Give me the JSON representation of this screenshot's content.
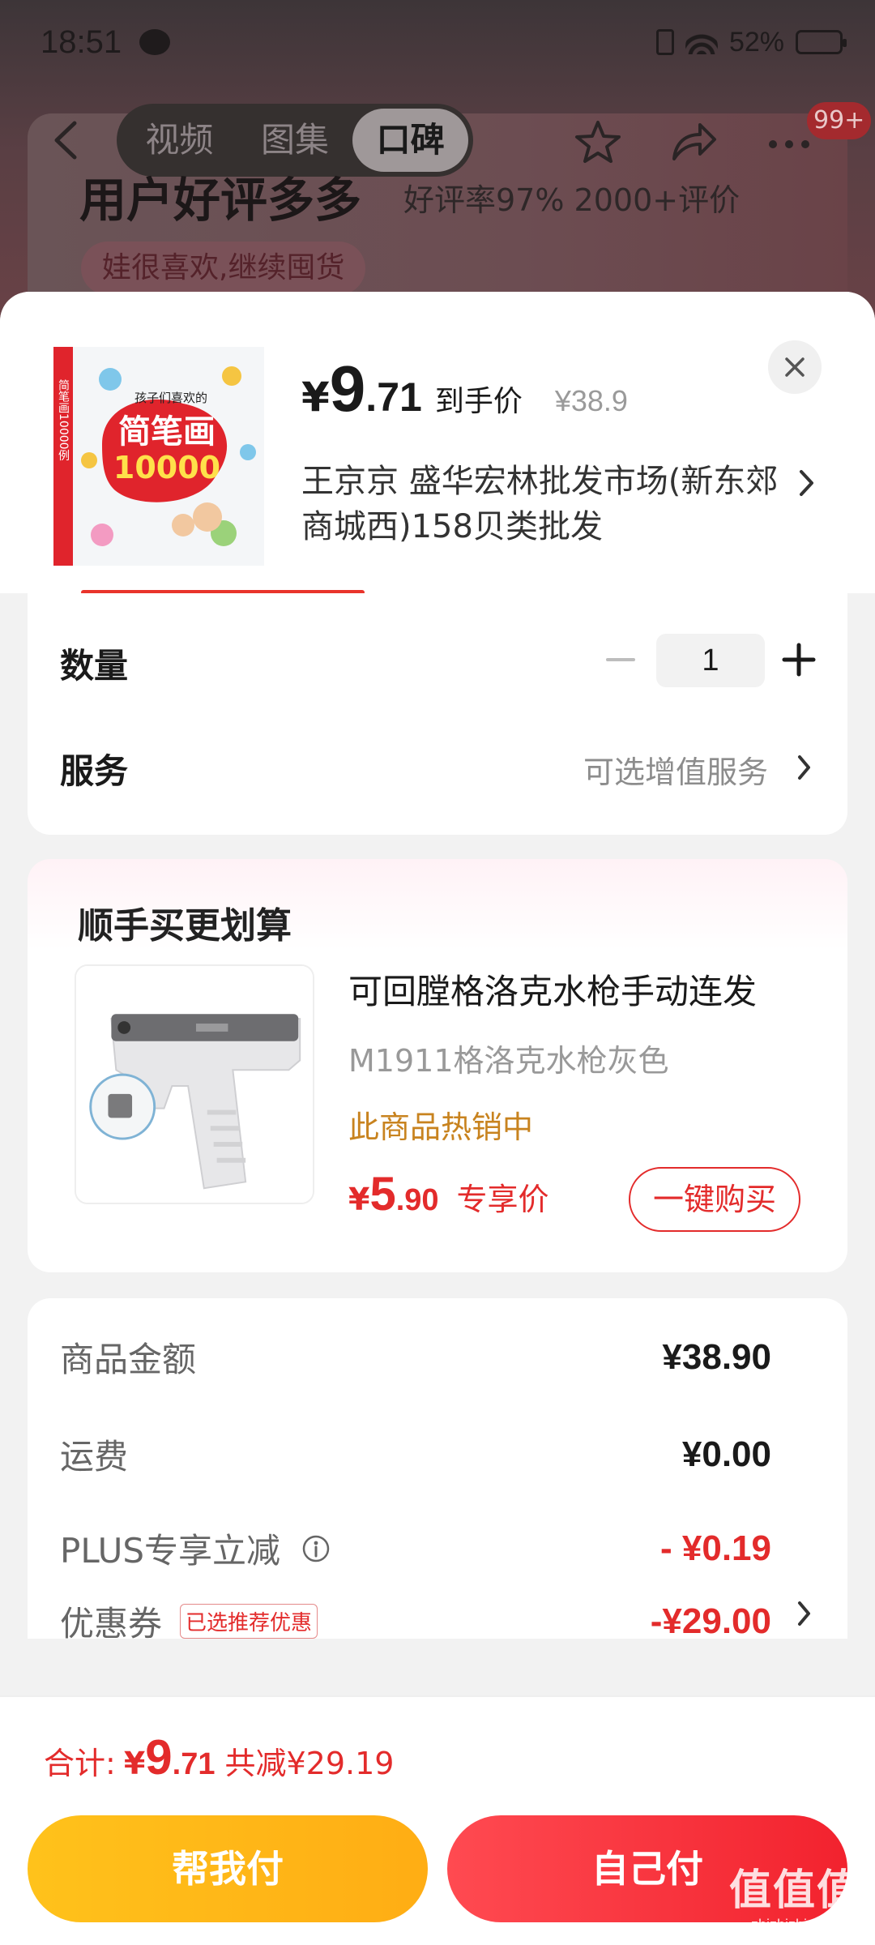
{
  "status_bar": {
    "time": "18:51",
    "battery": "52%"
  },
  "nav": {
    "tabs": [
      "视频",
      "图集",
      "口碑"
    ],
    "active_tab": 2,
    "badge": "99+"
  },
  "background": {
    "title": "用户好评多多",
    "subtitle": "好评率97% 2000+评价",
    "tag": "娃很喜欢,继续囤货"
  },
  "product": {
    "price_symbol": "¥",
    "price_int": "9",
    "price_dec": ".71",
    "price_label": "到手价",
    "original_price": "¥38.9",
    "address": "王京京  盛华宏林批发市场(新东郊商城西)158贝类批发",
    "cover": {
      "top_text": "孩子们喜欢的",
      "title": "简笔画",
      "number": "10000",
      "spine": "简笔画10000例"
    }
  },
  "options": {
    "quantity_label": "数量",
    "quantity": "1",
    "service_label": "服务",
    "service_value": "可选增值服务"
  },
  "upsell": {
    "title": "顺手买更划算",
    "item_title": "可回膛格洛克水枪手动连发",
    "item_spec": "M1911格洛克水枪灰色",
    "item_hot": "此商品热销中",
    "price_symbol": "¥",
    "price_int": "5",
    "price_dec": ".90",
    "price_label": "专享价",
    "buy_label": "一键购买"
  },
  "summary": {
    "rows": [
      {
        "label": "商品金额",
        "value": "¥38.90"
      },
      {
        "label": "运费",
        "value": "¥0.00"
      },
      {
        "label": "PLUS专享立减",
        "value": "- ¥0.19"
      },
      {
        "label": "优惠券",
        "value": "-¥29.00",
        "tag": "已选推荐优惠"
      }
    ]
  },
  "footer": {
    "total_label": "合计:",
    "total_symbol": "¥",
    "total_int": "9",
    "total_dec": ".71",
    "saved": "共减¥29.19",
    "help_pay": "帮我付",
    "self_pay": "自己付"
  },
  "watermark": {
    "line1": "值值值",
    "line2": "zhizhizhi.com"
  },
  "colors": {
    "accent_red": "#e32b2b",
    "gold": "#c8831f",
    "help_btn": "#ffb618",
    "self_btn": "#f5323c"
  }
}
